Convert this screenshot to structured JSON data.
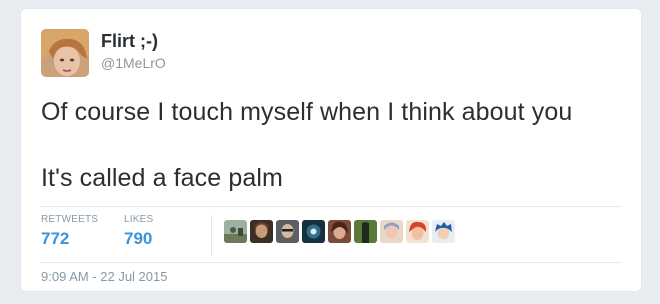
{
  "author": {
    "display_name": "Flirt ;-)",
    "screen_name": "@1MeLrO",
    "avatar_icon": "user-avatar-photo"
  },
  "tweet": {
    "text_line_1": "Of course I touch myself when I think about you",
    "text_line_2": "It's called a face palm"
  },
  "stats": {
    "retweets_label": "RETWEETS",
    "retweets_count": "772",
    "likes_label": "LIKES",
    "likes_count": "790"
  },
  "likers": [
    {
      "icon": "liker-avatar-1",
      "color": "#7a8a70"
    },
    {
      "icon": "liker-avatar-2",
      "color": "#5a4a3a"
    },
    {
      "icon": "liker-avatar-3",
      "color": "#4a4f55"
    },
    {
      "icon": "liker-avatar-4",
      "color": "#1f3a4a"
    },
    {
      "icon": "liker-avatar-5",
      "color": "#8a5a4a"
    },
    {
      "icon": "liker-avatar-6",
      "color": "#3a4a2a"
    },
    {
      "icon": "liker-avatar-7",
      "color": "#c8a890"
    },
    {
      "icon": "liker-avatar-8",
      "color": "#c84a3a"
    },
    {
      "icon": "liker-avatar-9",
      "color": "#2a5a8a"
    }
  ],
  "meta": {
    "timestamp": "9:09 AM - 22 Jul 2015"
  },
  "colors": {
    "link_blue": "#3b94d9",
    "muted": "#8899a6",
    "text": "#292f33"
  }
}
